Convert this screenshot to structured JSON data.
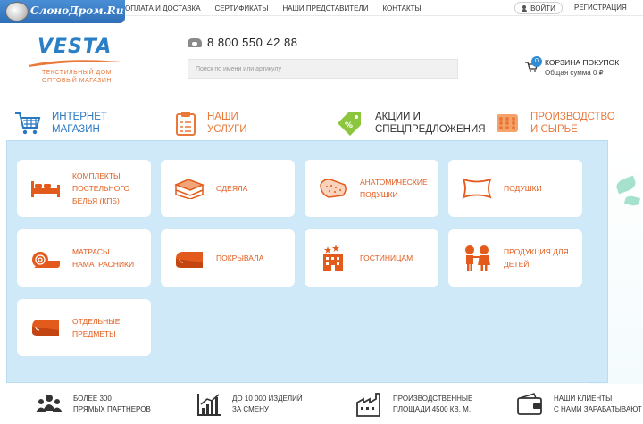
{
  "watermark": {
    "text": "СлоноДром.Ru"
  },
  "topnav": {
    "items": [
      {
        "label": "ОПЛАТА И ДОСТАВКА"
      },
      {
        "label": "СЕРТИФИКАТЫ"
      },
      {
        "label": "НАШИ ПРЕДСТАВИТЕЛИ"
      },
      {
        "label": "КОНТАКТЫ"
      }
    ],
    "login_label": "ВОЙТИ",
    "register_label": "РЕГИСТРАЦИЯ"
  },
  "header": {
    "logo": {
      "word": "VESTA",
      "line1": "ТЕКСТИЛЬНЫЙ ДОМ",
      "line2": "ОПТОВЫЙ МАГАЗИН"
    },
    "phone": "8 800 550 42 88",
    "search": {
      "placeholder": "Поиск по имени или артикулу",
      "value": ""
    },
    "cart": {
      "count": "0",
      "title": "КОРЗИНА ПОКУПОК",
      "sum": "Общая сумма 0 ₽"
    }
  },
  "categories": [
    {
      "label": "ИНТЕРНЕТ\nМАГАЗИН",
      "icon": "cart-icon"
    },
    {
      "label": "НАШИ\nУСЛУГИ",
      "icon": "clipboard-icon"
    },
    {
      "label": "АКЦИИ И\nСПЕЦПРЕДЛОЖЕНИЯ",
      "icon": "discount-tag-icon"
    },
    {
      "label": "ПРОИЗВОДСТВО\nИ СЫРЬЕ",
      "icon": "fabric-icon"
    }
  ],
  "menu": {
    "tiles": [
      {
        "label": "КОМПЛЕКТЫ\nПОСТЕЛЬНОГО\nБЕЛЬЯ (КПБ)",
        "icon": "bed-icon"
      },
      {
        "label": "ОДЕЯЛА",
        "icon": "blanket-icon"
      },
      {
        "label": "АНАТОМИЧЕСКИЕ\nПОДУШКИ",
        "icon": "anatomical-pillow-icon"
      },
      {
        "label": "ПОДУШКИ",
        "icon": "pillow-icon"
      },
      {
        "label": "МАТРАСЫ\nНАМАТРАСНИКИ",
        "icon": "mattress-roll-icon"
      },
      {
        "label": "ПОКРЫВАЛА",
        "icon": "bedspread-icon"
      },
      {
        "label": "ГОСТИНИЦАМ",
        "icon": "hotel-icon"
      },
      {
        "label": "ПРОДУКЦИЯ ДЛЯ\nДЕТЕЙ",
        "icon": "children-icon"
      },
      {
        "label": "ОТДЕЛЬНЫЕ\nПРЕДМЕТЫ",
        "icon": "separate-items-icon"
      }
    ]
  },
  "stats": [
    {
      "label": "БОЛЕЕ 300\nПРЯМЫХ ПАРТНЕРОВ",
      "icon": "partners-icon"
    },
    {
      "label": "ДО 10 000 ИЗДЕЛИЙ\nЗА СМЕНУ",
      "icon": "growth-chart-icon"
    },
    {
      "label": "ПРОИЗВОДСТВЕННЫЕ\nПЛОЩАДИ 4500 КВ. М.",
      "icon": "factory-icon"
    },
    {
      "label": "НАШИ КЛИЕНТЫ\nС НАМИ ЗАРАБАТЫВАЮТ",
      "icon": "wallet-icon"
    }
  ],
  "colors": {
    "brand_blue": "#2a78c2",
    "accent_orange": "#e8793b",
    "tile_text": "#e25b1c",
    "panel_bg": "#cfe9f8",
    "cart_badge": "#2f8bd2"
  }
}
